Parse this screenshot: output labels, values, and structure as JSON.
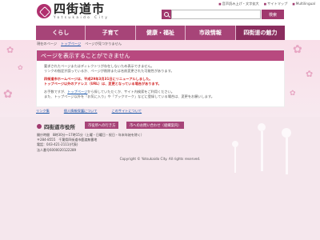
{
  "utility_links": [
    "音声読み上げ・文字拡大",
    "サイトマップ",
    "Multilingual"
  ],
  "logo": {
    "title": "四街道市",
    "subtitle": "Yotsukaido City"
  },
  "search": {
    "placeholder": "",
    "button": "検索"
  },
  "nav": [
    "くらし",
    "子育て",
    "健康・福祉",
    "市政情報",
    "四街道の魅力"
  ],
  "breadcrumb": {
    "home": "現在のページ",
    "link": "トップページ",
    "current": "ページが見つかりません"
  },
  "notice": {
    "title": "ページを表示することができません",
    "line1": "要求されたページまたはディレクトリが存在しないため表示できません。",
    "line2": "リンクの指定が誤っているか、ページが削除または名前変更された可能性があります。",
    "red1": "四街道市ホームページは、平成29年3月31日にリニューアルしました。",
    "red2": "トップページ以外のアドレス（URL）は、変更となっている場合があります。",
    "line3a": "お手数ですが、",
    "line3link": "トップページ",
    "line3b": "から探していただくか、サイト内検索をご利用ください。",
    "line4": "また、トップページ以外を「お気に入り」や「ブックマーク」などに登録している場合は、変更をお願いします。"
  },
  "footer_links": [
    "リンク集",
    "個人情報保護について",
    "このサイトについて"
  ],
  "office": {
    "name": "四街道市役所",
    "button1": "市役所への行き方",
    "button2": "市へのお問い合わせ（組織案内）",
    "hours": "開庁時間　8時30分～17時15分（土曜・日曜日・祝日・年末年始を除く）",
    "address": "〒284-8555　千葉県四街道市鹿渡無番地",
    "phone": "電話：043-421-2111(代表)",
    "corp": "法人番号6000020122289"
  },
  "copyright": "Copyright © Yotsukaido City. All rights reserved.",
  "colors": {
    "brand": "#a74478",
    "alert": "#d12222",
    "link": "#1a56a8"
  }
}
